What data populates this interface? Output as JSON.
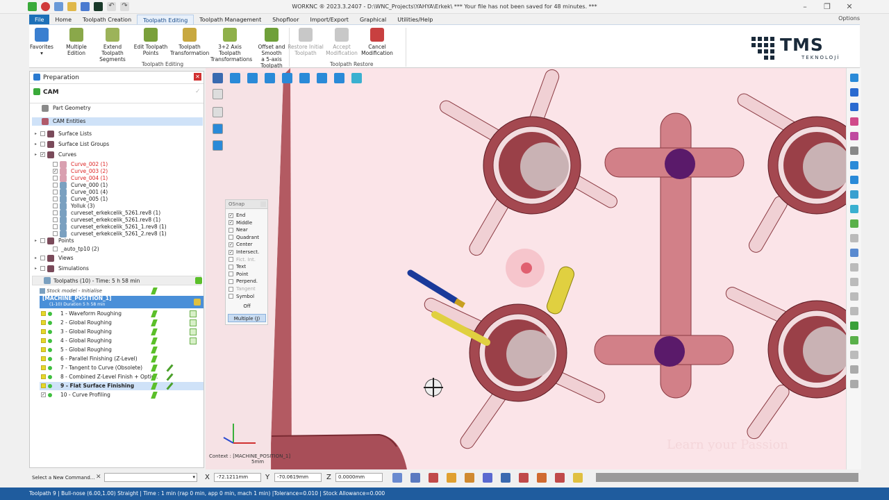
{
  "window": {
    "title": "WORKNC ® 2023.3.2407 - D:\\WNC_Projects\\YAHYA\\Erkek\\ *** Your file has not been saved for 48 minutes. ***"
  },
  "menu": [
    "File",
    "Home",
    "Toolpath Creation",
    "Toolpath Editing",
    "Toolpath Management",
    "Shopfloor",
    "Import/Export",
    "Graphical",
    "Utilities/Help"
  ],
  "menu_options": "Options",
  "ribbon": {
    "buttons": [
      {
        "label": "Favorites",
        "sub": "▾",
        "icon": "favorites-icon",
        "color": "#3a7fd0",
        "disabled": false
      },
      {
        "label": "Multiple",
        "sub": "Edition",
        "icon": "multiple-edition-icon",
        "color": "#8aa84a",
        "disabled": false
      },
      {
        "label": "Extend Toolpath",
        "sub": "Segments",
        "icon": "extend-segments-icon",
        "color": "#9cb35a",
        "disabled": false
      },
      {
        "label": "Edit Toolpath",
        "sub": "Points",
        "icon": "edit-points-icon",
        "color": "#7aa03a",
        "disabled": false
      },
      {
        "label": "Toolpath",
        "sub": "Transformation",
        "icon": "transformation-icon",
        "color": "#c8a840",
        "disabled": false
      },
      {
        "label": "3+2 Axis Toolpath",
        "sub": "Transformations",
        "icon": "axis-transform-icon",
        "color": "#8fb04a",
        "disabled": false
      },
      {
        "label": "Offset and Smooth",
        "sub": "a 5-axis Toolpath",
        "icon": "offset-smooth-icon",
        "color": "#6fa03a",
        "disabled": false
      },
      {
        "label": "Restore Initial",
        "sub": "Toolpath",
        "icon": "restore-icon",
        "color": "#c8c8c8",
        "disabled": true
      },
      {
        "label": "Accept",
        "sub": "Modification",
        "icon": "accept-icon",
        "color": "#c8c8c8",
        "disabled": true
      },
      {
        "label": "Cancel",
        "sub": "Modification",
        "icon": "cancel-icon",
        "color": "#c84040",
        "disabled": false
      }
    ],
    "group_editing": "Toolpath Editing",
    "group_restore": "Toolpath Restore"
  },
  "logo": {
    "text": "TMS",
    "sub": "TEKNOLOJİ"
  },
  "panel": {
    "title": "Preparation",
    "cam": "CAM",
    "tree": [
      {
        "label": "Part Geometry",
        "indent": 12,
        "cb": false,
        "icon": "part-geometry-icon",
        "color": "#8a8a8a",
        "sel": false,
        "red": false
      },
      {
        "label": "CAM Entities",
        "indent": 12,
        "cb": false,
        "icon": "cam-entities-icon",
        "color": "#b05a6a",
        "sel": true,
        "red": false
      },
      {
        "label": "Surface Lists",
        "indent": 8,
        "cb": true,
        "icon": "surface-lists-icon",
        "color": "#7a4a5a",
        "sel": false,
        "red": false
      },
      {
        "label": "Surface List Groups",
        "indent": 8,
        "cb": true,
        "icon": "surface-groups-icon",
        "color": "#7a4a5a",
        "sel": false,
        "red": false
      },
      {
        "label": "Curves",
        "indent": 8,
        "cb": true,
        "checked": true,
        "icon": "curves-icon",
        "color": "#7a4a5a",
        "sel": false,
        "red": false
      },
      {
        "label": "Curve_002 (1)",
        "indent": 26,
        "cb": true,
        "icon": "curve-icon",
        "color": "#d9a0b0",
        "sel": false,
        "red": true
      },
      {
        "label": "Curve_003 (2)",
        "indent": 26,
        "cb": true,
        "checked": true,
        "icon": "curve-icon",
        "color": "#d9a0b0",
        "sel": false,
        "red": true
      },
      {
        "label": "Curve_004 (1)",
        "indent": 26,
        "cb": true,
        "icon": "curve-icon",
        "color": "#d9a0b0",
        "sel": false,
        "red": true
      },
      {
        "label": "Curve_000 (1)",
        "indent": 26,
        "cb": true,
        "icon": "curve-icon",
        "color": "#7aa0c0",
        "sel": false,
        "red": false
      },
      {
        "label": "Curve_001 (4)",
        "indent": 26,
        "cb": true,
        "icon": "curve-icon",
        "color": "#7aa0c0",
        "sel": false,
        "red": false
      },
      {
        "label": "Curve_005 (1)",
        "indent": 26,
        "cb": true,
        "icon": "curve-icon",
        "color": "#7aa0c0",
        "sel": false,
        "red": false
      },
      {
        "label": "Yolluk (3)",
        "indent": 26,
        "cb": true,
        "icon": "curve-icon",
        "color": "#7aa0c0",
        "sel": false,
        "red": false
      },
      {
        "label": "curveset_erkekcelik_5261.rev8 (1)",
        "indent": 26,
        "cb": true,
        "icon": "curve-icon",
        "color": "#7aa0c0",
        "sel": false,
        "red": false
      },
      {
        "label": "curveset_erkekcelik_5261.rev8 (1)",
        "indent": 26,
        "cb": true,
        "icon": "curve-icon",
        "color": "#7aa0c0",
        "sel": false,
        "red": false
      },
      {
        "label": "curveset_erkekcelik_5261_1.rev8 (1)",
        "indent": 26,
        "cb": true,
        "icon": "curve-icon",
        "color": "#7aa0c0",
        "sel": false,
        "red": false
      },
      {
        "label": "curveset_erkekcelik_5261_2.rev8 (1)",
        "indent": 26,
        "cb": true,
        "icon": "curve-icon",
        "color": "#7aa0c0",
        "sel": false,
        "red": false
      },
      {
        "label": "Points",
        "indent": 8,
        "cb": true,
        "icon": "points-icon",
        "color": "#7a4a5a",
        "sel": false,
        "red": false
      },
      {
        "label": "_auto_tp10 (2)",
        "indent": 26,
        "cb": true,
        "icon": "none",
        "color": "",
        "sel": false,
        "red": false
      },
      {
        "label": "Views",
        "indent": 8,
        "cb": true,
        "icon": "views-icon",
        "color": "#7a4a5a",
        "sel": false,
        "red": false
      },
      {
        "label": "Simulations",
        "indent": 8,
        "cb": true,
        "icon": "simulations-icon",
        "color": "#7a4a5a",
        "sel": false,
        "red": false
      }
    ],
    "toolpaths_header": "Toolpaths (10) - Time: 5 h 58 min",
    "stock_model": "Stock model - Initialise",
    "machine": "[MACHINE_POSITION_1]",
    "machine_sub": "(1-10) Duration 5 h 58 min",
    "toolpaths": [
      {
        "label": "1 - Waveform Roughing",
        "bold": false,
        "checked": false
      },
      {
        "label": "2 - Global Roughing",
        "bold": false,
        "checked": false
      },
      {
        "label": "3 - Global Roughing",
        "bold": false,
        "checked": false
      },
      {
        "label": "4 - Global Roughing",
        "bold": false,
        "checked": false
      },
      {
        "label": "5 - Global Roughing",
        "bold": false,
        "checked": false
      },
      {
        "label": "6 - Parallel Finishing (Z-Level)",
        "bold": false,
        "checked": false
      },
      {
        "label": "7 - Tangent to Curve (Obsolete)",
        "bold": false,
        "checked": false
      },
      {
        "label": "8 - Combined Z-Level Finish + Optim.",
        "bold": false,
        "checked": false
      },
      {
        "label": "9 - Flat Surface Finishing",
        "bold": true,
        "checked": false
      },
      {
        "label": "10 - Curve Profiling",
        "bold": false,
        "checked": true
      }
    ]
  },
  "osnap": {
    "title": "OSnap",
    "items": [
      {
        "label": "End",
        "checked": true,
        "dim": false
      },
      {
        "label": "Middle",
        "checked": true,
        "dim": false
      },
      {
        "label": "Near",
        "checked": false,
        "dim": false
      },
      {
        "label": "Quadrant",
        "checked": false,
        "dim": false
      },
      {
        "label": "Center",
        "checked": true,
        "dim": false
      },
      {
        "label": "Intersect.",
        "checked": true,
        "dim": false
      },
      {
        "label": "Fict. Int.",
        "checked": false,
        "dim": true
      },
      {
        "label": "Text",
        "checked": false,
        "dim": false
      },
      {
        "label": "Point",
        "checked": false,
        "dim": false
      },
      {
        "label": "Perpend.",
        "checked": false,
        "dim": false
      },
      {
        "label": "Tangent",
        "checked": false,
        "dim": true
      },
      {
        "label": "Symbol",
        "checked": false,
        "dim": false
      }
    ],
    "off_label": "Off",
    "multiple_label": "Multiple (J)"
  },
  "viewport": {
    "context": "Context : [MACHINE_POSITION_1]",
    "scale": "5mm",
    "watermark": "Learn your Passion"
  },
  "cmd": {
    "prompt": "Select a New Command...",
    "x_label": "X",
    "x_value": "-72.1211mm",
    "y_label": "Y",
    "y_value": "-70.0619mm",
    "z_label": "Z",
    "z_value": "0.0000mm"
  },
  "status": "Toolpath 9 | Bull-nose (6.00,1.00) Straight | Time : 1 min (rap 0 min, app 0 min, mach 1 min) |Tolerance=0.010 | Stock Allowance=0.000"
}
